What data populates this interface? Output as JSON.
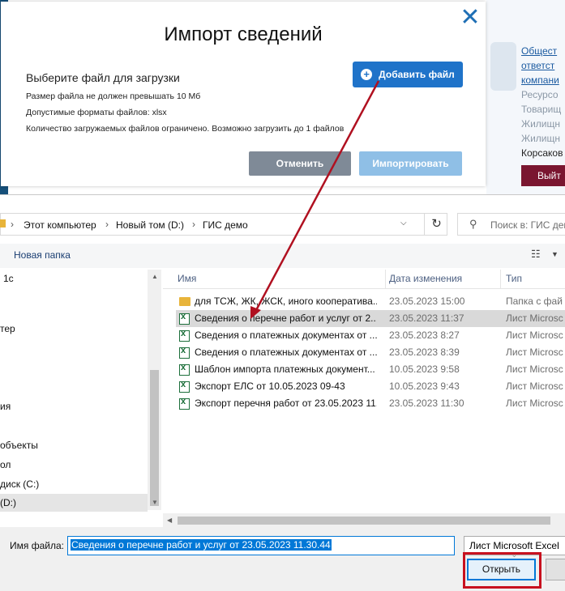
{
  "background": {
    "links": [
      "Общест",
      "ответст",
      "компани"
    ],
    "texts": [
      "Ресурсо",
      "Товарищ",
      "Жилищн",
      "Жилищн"
    ],
    "user": "Корсаков",
    "logout": "Выйт"
  },
  "modal": {
    "title": "Импорт сведений",
    "subtitle": "Выберите файл для загрузки",
    "note_size": "Размер файла не должен превышать 10 Мб",
    "note_formats": "Допустимые форматы файлов: xlsx",
    "note_count": "Количество загружаемых файлов ограничено. Возможно загрузить до 1 файлов",
    "add_file": "Добавить файл",
    "cancel": "Отменить",
    "import": "Импортировать",
    "close": "✕"
  },
  "dialog": {
    "breadcrumb": [
      "Этот компьютер",
      "Новый том (D:)",
      "ГИС демо"
    ],
    "search_placeholder": "Поиск в: ГИС демо",
    "new_folder": "Новая папка",
    "nav_items": [
      "1с",
      "тер",
      "ия",
      "объекты",
      "ол",
      "диск (C:)",
      "(D:)"
    ],
    "columns": {
      "name": "Имя",
      "date": "Дата изменения",
      "type": "Тип"
    },
    "files": [
      {
        "name": "для ТСЖ, ЖК, ЖСК, иного кооператива...",
        "date": "23.05.2023 15:00",
        "type": "Папка с фай",
        "kind": "folder"
      },
      {
        "name": "Сведения о перечне работ и услуг от 2...",
        "date": "23.05.2023 11:37",
        "type": "Лист Microsc",
        "kind": "xlsx"
      },
      {
        "name": "Сведения о платежных документах от ...",
        "date": "23.05.2023 8:27",
        "type": "Лист Microsc",
        "kind": "xlsx"
      },
      {
        "name": "Сведения о платежных документах от ...",
        "date": "23.05.2023 8:39",
        "type": "Лист Microsc",
        "kind": "xlsx"
      },
      {
        "name": "Шаблон импорта платежных документ...",
        "date": "10.05.2023 9:58",
        "type": "Лист Microsc",
        "kind": "xlsx"
      },
      {
        "name": "Экспорт ЕЛС от 10.05.2023 09-43",
        "date": "10.05.2023 9:43",
        "type": "Лист Microsc",
        "kind": "xlsx"
      },
      {
        "name": "Экспорт перечня работ от 23.05.2023 11...",
        "date": "23.05.2023 11:30",
        "type": "Лист Microsc",
        "kind": "xlsx"
      }
    ],
    "filename_label": "Имя файла:",
    "filename_value": "Сведения о перечне работ и услуг от 23.05.2023 11.30.44",
    "file_type": "Лист Microsoft Excel",
    "open": "Открыть"
  },
  "colors": {
    "accent": "#1f73c9",
    "highlight": "#c8101e",
    "arrow": "#b01020"
  }
}
